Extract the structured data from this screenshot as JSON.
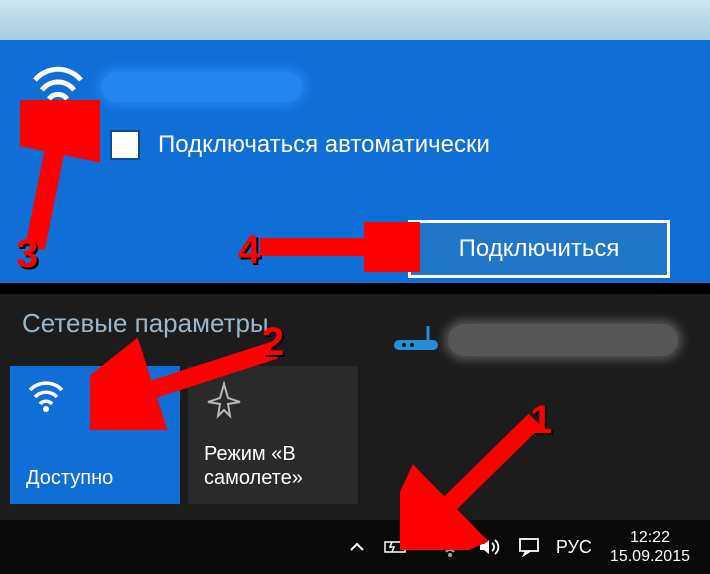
{
  "wifi_panel": {
    "auto_connect_label": "Подключаться автоматически",
    "connect_button": "Подключиться"
  },
  "network_settings": {
    "title": "Сетевые параметры",
    "tiles": [
      {
        "label": "Доступно"
      },
      {
        "label": "Режим «В\nсамолете»"
      }
    ]
  },
  "tray": {
    "language": "РУС",
    "time": "12:22",
    "date": "15.09.2015"
  },
  "annotations": {
    "n1": "1",
    "n2": "2",
    "n3": "3",
    "n4": "4"
  }
}
